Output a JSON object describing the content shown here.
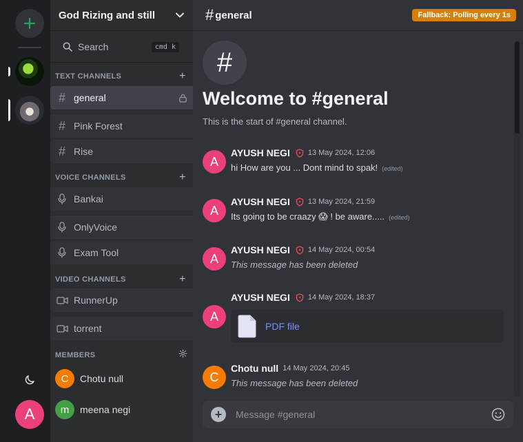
{
  "server": {
    "name": "God Rizing and still"
  },
  "search": {
    "label": "Search",
    "shortcut": "cmd k"
  },
  "categories": {
    "text": "TEXT CHANNELS",
    "voice": "VOICE CHANNELS",
    "video": "VIDEO CHANNELS",
    "members": "MEMBERS"
  },
  "text_channels": [
    {
      "name": "general",
      "active": true
    },
    {
      "name": "Pink Forest"
    },
    {
      "name": "Rise"
    }
  ],
  "voice_channels": [
    {
      "name": "Bankai"
    },
    {
      "name": "OnlyVoice"
    },
    {
      "name": "Exam Tool"
    }
  ],
  "video_channels": [
    {
      "name": "RunnerUp"
    },
    {
      "name": "torrent"
    }
  ],
  "members": [
    {
      "initial": "C",
      "name": "Chotu null",
      "color": "#f57c00"
    },
    {
      "initial": "m",
      "name": "meena negi",
      "color": "#43a047"
    }
  ],
  "user": {
    "initial": "A",
    "color": "#ec407a"
  },
  "channel": {
    "hash": "#",
    "title": "general",
    "status_badge": "Fallback: Polling every 1s",
    "welcome_title": "Welcome to #general",
    "welcome_sub": "This is the start of #general channel."
  },
  "messages": [
    {
      "initial": "A",
      "author": "AYUSH NEGI",
      "time": "13 May 2024, 12:06",
      "text": "hi How are you ... Dont mind to spak!",
      "edited": "(edited)",
      "color": "#ec407a"
    },
    {
      "initial": "A",
      "author": "AYUSH NEGI",
      "time": "13 May 2024, 21:59",
      "text": "Its going to be craazy 😱 ! be aware.....",
      "edited": "(edited)",
      "color": "#ec407a"
    },
    {
      "initial": "A",
      "author": "AYUSH NEGI",
      "time": "14 May 2024, 00:54",
      "text": "This message has been deleted",
      "color": "#ec407a"
    },
    {
      "initial": "A",
      "author": "AYUSH NEGI",
      "time": "14 May 2024, 18:37",
      "file": "PDF file",
      "color": "#ec407a"
    },
    {
      "initial": "C",
      "author": "Chotu null",
      "time": "14 May 2024, 20:45",
      "text": "This message has been deleted",
      "color": "#f57c00"
    }
  ],
  "composer": {
    "placeholder": "Message #general"
  }
}
